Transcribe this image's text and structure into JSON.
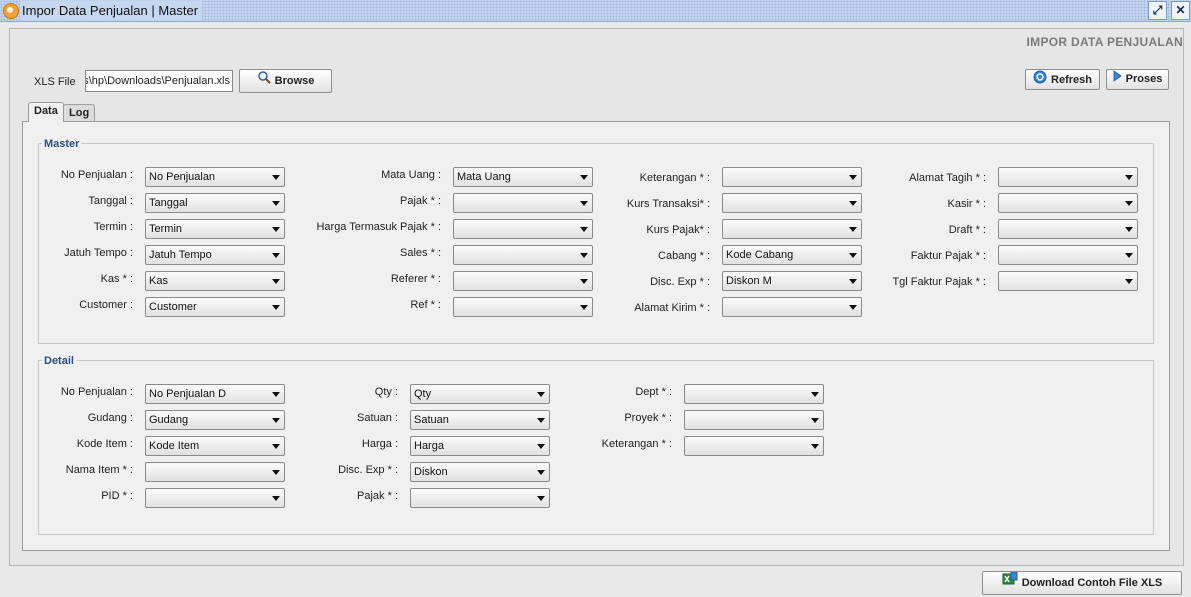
{
  "window": {
    "title": "Impor Data Penjualan | Master",
    "restore_glyph": "⤢",
    "close_glyph": "✕"
  },
  "heading": "IMPOR DATA PENJUALAN",
  "xls": {
    "label": "XLS File",
    "value": "C:\\Users\\hp\\Downloads\\Penjualan.xls",
    "browse_label": "Browse"
  },
  "actions": {
    "refresh_label": "Refresh",
    "proses_label": "Proses"
  },
  "tabs": [
    {
      "label": "Data"
    },
    {
      "label": "Log"
    }
  ],
  "master": {
    "title": "Master",
    "col1": [
      {
        "label": "No Penjualan :",
        "value": "No Penjualan"
      },
      {
        "label": "Tanggal :",
        "value": "Tanggal"
      },
      {
        "label": "Termin :",
        "value": "Termin"
      },
      {
        "label": "Jatuh Tempo :",
        "value": "Jatuh Tempo"
      },
      {
        "label": "Kas * :",
        "value": "Kas"
      },
      {
        "label": "Customer :",
        "value": "Customer"
      }
    ],
    "col2": [
      {
        "label": "Mata Uang :",
        "value": "Mata Uang"
      },
      {
        "label": "Pajak * :",
        "value": ""
      },
      {
        "label": "Harga Termasuk Pajak * :",
        "value": ""
      },
      {
        "label": "Sales * :",
        "value": ""
      },
      {
        "label": "Referer * :",
        "value": ""
      },
      {
        "label": "Ref * :",
        "value": ""
      }
    ],
    "col3": [
      {
        "label": "Keterangan * :",
        "value": ""
      },
      {
        "label": "Kurs Transaksi* :",
        "value": ""
      },
      {
        "label": "Kurs Pajak* :",
        "value": ""
      },
      {
        "label": "Cabang * :",
        "value": "Kode Cabang"
      },
      {
        "label": "Disc. Exp * :",
        "value": "Diskon M"
      },
      {
        "label": "Alamat Kirim * :",
        "value": ""
      }
    ],
    "col4": [
      {
        "label": "Alamat Tagih * :",
        "value": ""
      },
      {
        "label": "Kasir * :",
        "value": ""
      },
      {
        "label": "Draft * :",
        "value": ""
      },
      {
        "label": "Faktur Pajak * :",
        "value": ""
      },
      {
        "label": "Tgl Faktur Pajak * :",
        "value": ""
      }
    ]
  },
  "detail": {
    "title": "Detail",
    "col1": [
      {
        "label": "No Penjualan :",
        "value": "No Penjualan D"
      },
      {
        "label": "Gudang :",
        "value": "Gudang"
      },
      {
        "label": "Kode Item :",
        "value": "Kode Item"
      },
      {
        "label": "Nama Item * :",
        "value": ""
      },
      {
        "label": "PID * :",
        "value": ""
      }
    ],
    "col2": [
      {
        "label": "Qty :",
        "value": "Qty"
      },
      {
        "label": "Satuan :",
        "value": "Satuan"
      },
      {
        "label": "Harga :",
        "value": "Harga"
      },
      {
        "label": "Disc. Exp * :",
        "value": "Diskon"
      },
      {
        "label": "Pajak * :",
        "value": ""
      }
    ],
    "col3": [
      {
        "label": "Dept * :",
        "value": ""
      },
      {
        "label": "Proyek * :",
        "value": ""
      },
      {
        "label": "Keterangan * :",
        "value": ""
      }
    ]
  },
  "download_label": "Download Contoh File XLS"
}
